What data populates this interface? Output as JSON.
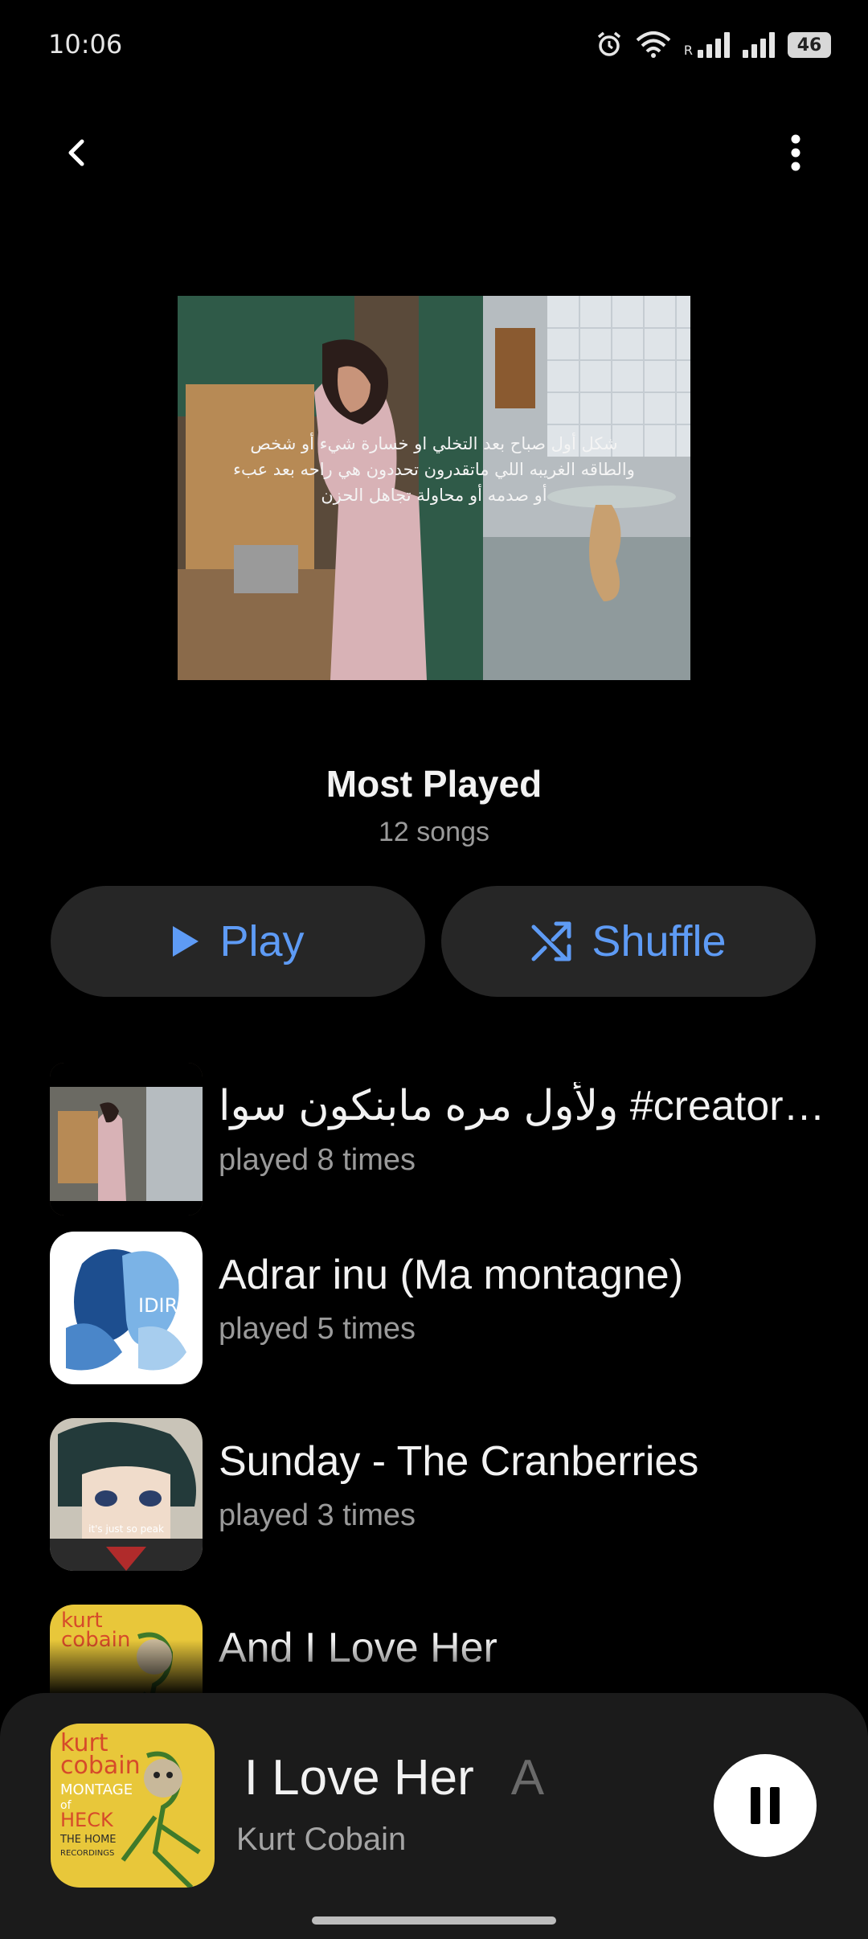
{
  "status_bar": {
    "time": "10:06",
    "battery": "46",
    "roaming_mark": "R",
    "icons": [
      "alarm-icon",
      "wifi-icon",
      "signal-icon",
      "signal-icon",
      "battery-icon"
    ]
  },
  "nav": {
    "back_icon": "chevron-left-icon",
    "menu_icon": "more-vert-icon"
  },
  "playlist": {
    "title": "Most Played",
    "count": "12 songs",
    "cover_caption": "شكل أول صباح بعد التخلي او خسارة شيء أو شخص والطاقه الغريبه اللي ماتقدرون تحددون هي راحه بعد عبء أو صدمه أو محاولة تجاهل الحزن"
  },
  "actions": {
    "play_label": "Play",
    "shuffle_label": "Shuffle",
    "accent": "#5e9bf5"
  },
  "songs": [
    {
      "title": "ولأول مره مابنكون سوا #creators...",
      "plays": "played 8 times",
      "art": "kitchen-scene"
    },
    {
      "title": "Adrar inu (Ma montagne)",
      "plays": "played 5 times",
      "art": "idir-album",
      "art_text": "IDIR"
    },
    {
      "title": "Sunday - The Cranberries",
      "plays": "played 3 times",
      "art": "anime-boy",
      "art_text": "it's just so peak"
    },
    {
      "title": "And I Love Her",
      "plays": "",
      "art": "montage-of-heck"
    }
  ],
  "now_playing": {
    "title": "d I Love Her",
    "title_ghost": "A",
    "artist": "Kurt Cobain",
    "art_text": [
      "kurt",
      "cobain",
      "MONTAGE",
      "of",
      "HECK",
      "THE HOME",
      "RECORDINGS"
    ]
  }
}
